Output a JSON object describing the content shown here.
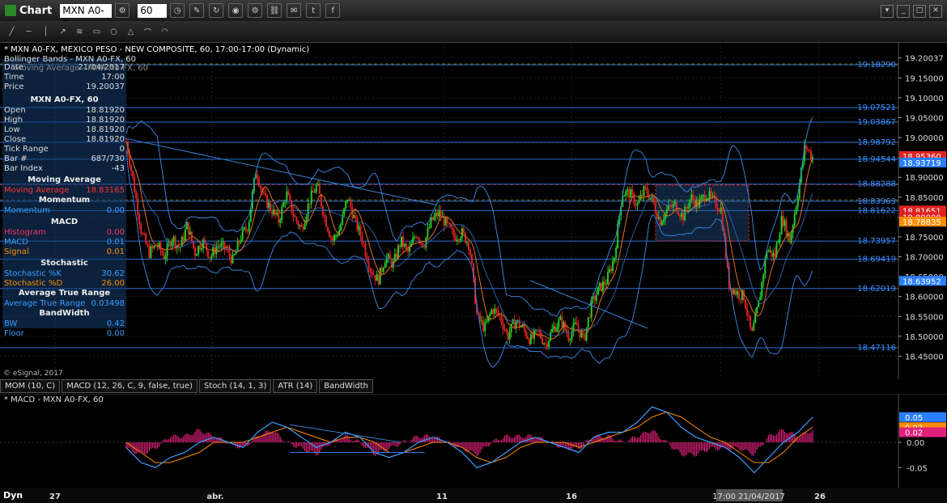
{
  "window": {
    "title": "Chart",
    "symbol": "MXN A0-FX",
    "interval": "60"
  },
  "chart_header": "* MXN A0-FX, MEXICO PESO - NEW COMPOSITE, 60, 17:00-17:00 (Dynamic)",
  "overlays": [
    "Bollinger Bands - MXN A0-FX, 60",
    "Moving Average - MXN A0-FX, 60"
  ],
  "data_window": {
    "top": [
      [
        "Date",
        "21/04/2017"
      ],
      [
        "Time",
        "17:00"
      ],
      [
        "Price",
        "19.20037"
      ]
    ],
    "symbol_header": "MXN A0-FX, 60",
    "ohlc": [
      [
        "Open",
        "18.81920"
      ],
      [
        "High",
        "18.81920"
      ],
      [
        "Low",
        "18.81920"
      ],
      [
        "Close",
        "18.81920"
      ],
      [
        "Tick Range",
        "0"
      ],
      [
        "Bar #",
        "687/730"
      ],
      [
        "Bar Index",
        "-43"
      ]
    ],
    "ma_header": "Moving Average",
    "ma": [
      "Moving Average",
      "18.83165"
    ],
    "mom_header": "Momentum",
    "mom": [
      "Momentum",
      "0.00"
    ],
    "macd_header": "MACD",
    "macd": [
      [
        "Histogram",
        "0.00"
      ],
      [
        "MACD",
        "0.01"
      ],
      [
        "Signal",
        "0.01"
      ]
    ],
    "stoch_header": "Stochastic",
    "stoch": [
      [
        "Stochastic %K",
        "30.62"
      ],
      [
        "Stochastic %D",
        "26.00"
      ]
    ],
    "atr_header": "Average True Range",
    "atr": [
      "Average True Range",
      "0.03498"
    ],
    "bw_header": "BandWidth",
    "bw": [
      [
        "BW",
        "0.42"
      ],
      [
        "Floor",
        "0.00"
      ]
    ]
  },
  "copyright": "© eSignal, 2017",
  "indicator_tabs": [
    "MOM (10, C)",
    "MACD (12, 26, C, 9, false, true)",
    "Stoch (14, 1, 3)",
    "ATR (14)",
    "BandWidth"
  ],
  "macd_title": "* MACD - MXN A0-FX, 60",
  "footer": {
    "dyn": "Dyn"
  },
  "colors": {
    "up": "#22cc22",
    "down": "#dd2222",
    "band": "#3a7fd5",
    "ma": "#e07020",
    "hline": "#2a6fd0",
    "macd_line": "#3aa0ff",
    "signal_line": "#ff8c00",
    "hist": "#e0207a"
  },
  "toolbar_icons": [
    "crosshair-icon",
    "line-icon",
    "ray-icon",
    "trend-icon",
    "fib-icon",
    "circle-icon",
    "rect-icon",
    "text-icon",
    "arrow-icon",
    "pitchfork-icon"
  ],
  "chart_data": [
    {
      "type": "candlestick",
      "title": "MXN A0-FX, 60",
      "ylim": [
        18.4,
        19.23
      ],
      "y_ticks": [
        "18.45000",
        "18.50000",
        "18.55000",
        "18.60000",
        "18.65000",
        "18.70000",
        "18.75000",
        "18.80000",
        "18.85000",
        "18.90000",
        "18.95000",
        "19.00000",
        "19.05000",
        "19.10000",
        "19.15000",
        "19.20037"
      ],
      "x_ticks": [
        "27",
        "abr.",
        "11",
        "16",
        "17:00 21/04/2017",
        "26"
      ],
      "horizontal_lines": [
        19.1829,
        19.07521,
        19.03867,
        18.98792,
        18.94544,
        18.88288,
        18.83963,
        18.81622,
        18.73957,
        18.69419,
        18.62019,
        18.47116
      ],
      "price_flags": [
        {
          "value": "18.95360",
          "color": "#dd2222"
        },
        {
          "value": "18.93719",
          "color": "#2a7fff"
        },
        {
          "value": "18.81651",
          "color": "#dd2222"
        },
        {
          "value": "18.80000",
          "color": "#dd2222"
        },
        {
          "value": "18.78835",
          "color": "#ff8c00"
        },
        {
          "value": "18.63952",
          "color": "#2a7fff"
        }
      ],
      "close_path": [
        18.99,
        18.88,
        18.76,
        18.71,
        18.73,
        18.7,
        18.75,
        18.72,
        18.78,
        18.71,
        18.74,
        18.7,
        18.73,
        18.72,
        18.69,
        18.75,
        18.78,
        18.92,
        18.85,
        18.82,
        18.79,
        18.86,
        18.8,
        18.77,
        18.84,
        18.88,
        18.8,
        18.74,
        18.77,
        18.85,
        18.79,
        18.74,
        18.67,
        18.64,
        18.7,
        18.68,
        18.74,
        18.71,
        18.76,
        18.73,
        18.79,
        18.81,
        18.78,
        18.75,
        18.76,
        18.73,
        18.55,
        18.52,
        18.57,
        18.55,
        18.5,
        18.54,
        18.52,
        18.49,
        18.51,
        18.48,
        18.52,
        18.54,
        18.5,
        18.53,
        18.49,
        18.58,
        18.62,
        18.64,
        18.7,
        18.86,
        18.86,
        18.83,
        18.87,
        18.84,
        18.79,
        18.82,
        18.83,
        18.8,
        18.85,
        18.83,
        18.86,
        18.84,
        18.82,
        18.63,
        18.61,
        18.6,
        18.5,
        18.59,
        18.72,
        18.7,
        18.8,
        18.74,
        18.85,
        18.98,
        18.95
      ]
    },
    {
      "type": "line",
      "title": "MACD - MXN A0-FX, 60",
      "ylim": [
        -0.08,
        0.08
      ],
      "y_ticks": [
        "-0.05",
        "0.00"
      ],
      "series": [
        {
          "name": "MACD",
          "values": [
            -0.01,
            -0.04,
            -0.05,
            -0.03,
            -0.02,
            0.0,
            0.01,
            0.0,
            -0.01,
            0.02,
            0.04,
            0.03,
            0.01,
            -0.01,
            0.0,
            0.02,
            0.01,
            -0.02,
            -0.03,
            -0.02,
            0.0,
            0.01,
            0.0,
            -0.02,
            -0.05,
            -0.04,
            -0.02,
            0.0,
            0.01,
            0.0,
            -0.01,
            -0.02,
            0.01,
            0.02,
            0.02,
            0.04,
            0.07,
            0.06,
            0.03,
            0.01,
            0.0,
            -0.01,
            -0.03,
            -0.06,
            -0.03,
            0.0,
            0.02,
            0.05
          ]
        },
        {
          "name": "Signal",
          "values": [
            0.0,
            -0.02,
            -0.04,
            -0.04,
            -0.03,
            -0.02,
            0.0,
            0.0,
            0.0,
            0.01,
            0.02,
            0.03,
            0.02,
            0.01,
            0.0,
            0.01,
            0.01,
            0.0,
            -0.02,
            -0.02,
            -0.01,
            0.0,
            0.0,
            -0.01,
            -0.03,
            -0.04,
            -0.03,
            -0.01,
            0.0,
            0.0,
            0.0,
            -0.01,
            0.0,
            0.01,
            0.02,
            0.03,
            0.05,
            0.06,
            0.05,
            0.03,
            0.01,
            0.0,
            -0.02,
            -0.04,
            -0.04,
            -0.02,
            0.01,
            0.03
          ]
        }
      ],
      "price_flags": [
        {
          "value": "0.05",
          "color": "#2a7fff"
        },
        {
          "value": "0.03",
          "color": "#ff8c00"
        },
        {
          "value": "0.02",
          "color": "#e0207a"
        }
      ]
    }
  ]
}
